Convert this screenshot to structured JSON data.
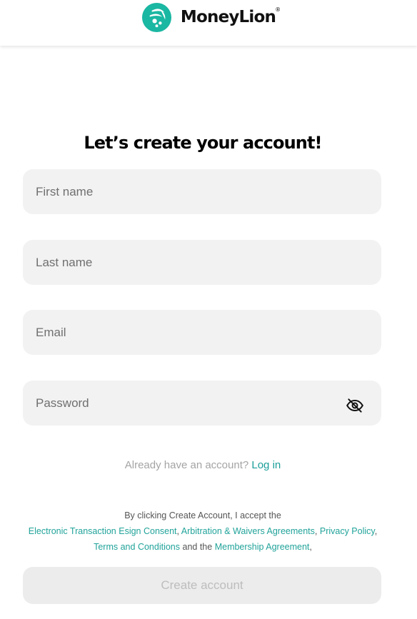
{
  "header": {
    "brand_name": "MoneyLion",
    "registered_mark": "®",
    "logo_icon": "moneylion-logo-icon",
    "brand_color": "#1ab7a2"
  },
  "form": {
    "title": "Let’s create your account!",
    "first_name": {
      "placeholder": "First name",
      "value": ""
    },
    "last_name": {
      "placeholder": "Last name",
      "value": ""
    },
    "email": {
      "placeholder": "Email",
      "value": ""
    },
    "password": {
      "placeholder": "Password",
      "value": "",
      "toggle_icon": "eye-slash-icon"
    }
  },
  "login": {
    "prompt": "Already have an account?",
    "link_label": "Log in"
  },
  "legal": {
    "intro": "By clicking Create Account, I accept the",
    "links": {
      "esign": "Electronic Transaction Esign Consent",
      "arbitration": "Arbitration & Waivers Agreements",
      "privacy": "Privacy Policy",
      "terms": "Terms and Conditions",
      "membership": "Membership Agreement"
    },
    "and_the": "and the"
  },
  "actions": {
    "create_label": "Create account"
  },
  "colors": {
    "field_bg": "#f2f2f2",
    "link": "#1b9e99",
    "button_disabled_bg": "#ececec",
    "button_disabled_text": "#bdbdbd"
  }
}
